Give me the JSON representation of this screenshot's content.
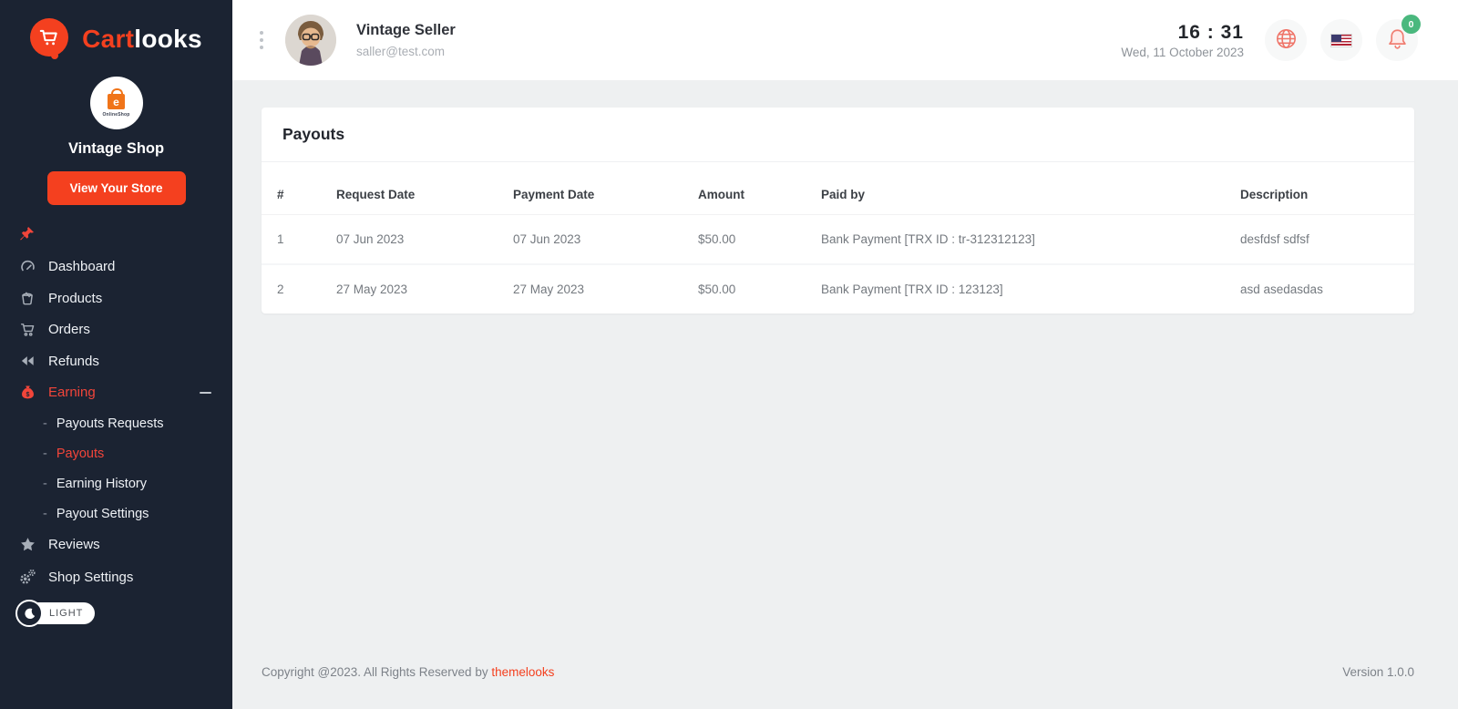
{
  "colors": {
    "accent": "#f4401f",
    "accent_red": "#f2453a",
    "sidebar_bg": "#1b2332",
    "badge_green": "#4ab87e",
    "main_bg": "#eef0f1"
  },
  "sidebar": {
    "logo": {
      "part1": "Cart",
      "part2": "looks"
    },
    "shop": {
      "avatar_letter": "e",
      "avatar_brand": "OnlineShop",
      "name": "Vintage Shop",
      "view_store_label": "View Your Store"
    },
    "items": [
      {
        "label": "Dashboard",
        "icon": "dashboard-gauge-icon",
        "active": false
      },
      {
        "label": "Products",
        "icon": "products-bucket-icon",
        "active": false
      },
      {
        "label": "Orders",
        "icon": "orders-cart-icon",
        "active": false
      },
      {
        "label": "Refunds",
        "icon": "refunds-rewind-icon",
        "active": false
      },
      {
        "label": "Earning",
        "icon": "earning-moneybag-icon",
        "active": true,
        "expanded": true,
        "children": [
          "Payouts Requests",
          "Payouts",
          "Earning History",
          "Payout Settings"
        ],
        "active_child": "Payouts"
      },
      {
        "label": "Reviews",
        "icon": "reviews-star-icon",
        "active": false
      },
      {
        "label": "Shop Settings",
        "icon": "shop-settings-gear-icon",
        "active": false
      }
    ],
    "theme_toggle_label": "LIGHT"
  },
  "header": {
    "user": {
      "name": "Vintage Seller",
      "email": "saller@test.com"
    },
    "clock": {
      "time": "16 : 31",
      "date": "Wed, 11 October 2023"
    },
    "notification_count": "0"
  },
  "payouts": {
    "title": "Payouts",
    "columns": [
      "#",
      "Request Date",
      "Payment Date",
      "Amount",
      "Paid by",
      "Description"
    ],
    "rows": [
      [
        "1",
        "07 Jun 2023",
        "07 Jun 2023",
        "$50.00",
        "Bank Payment [TRX ID : tr-312312123]",
        "desfdsf sdfsf"
      ],
      [
        "2",
        "27 May 2023",
        "27 May 2023",
        "$50.00",
        "Bank Payment [TRX ID : 123123]",
        "asd asedasdas"
      ]
    ]
  },
  "footer": {
    "copyright_prefix": "Copyright @2023. All Rights Reserved by ",
    "copyright_link": "themelooks",
    "version": "Version 1.0.0"
  }
}
